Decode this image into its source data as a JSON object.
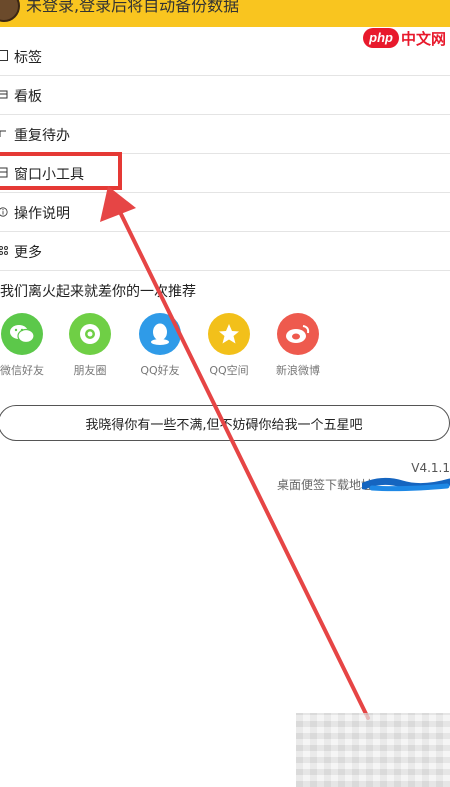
{
  "banner": {
    "text": "未登录,登录后将自动备份数据"
  },
  "watermark": {
    "badge": "php",
    "text": "中文网"
  },
  "menu": {
    "items": [
      {
        "label": "标签",
        "icon": "bookmark-icon"
      },
      {
        "label": "看板",
        "icon": "board-icon"
      },
      {
        "label": "重复待办",
        "icon": "repeat-icon"
      },
      {
        "label": "窗口小工具",
        "icon": "widget-icon"
      },
      {
        "label": "操作说明",
        "icon": "info-icon"
      },
      {
        "label": "更多",
        "icon": "more-icon"
      }
    ]
  },
  "share": {
    "title": "我们离火起来就差你的一次推荐",
    "targets": [
      {
        "label": "微信好友",
        "icon": "wechat-icon",
        "color": "#5cc84a"
      },
      {
        "label": "朋友圈",
        "icon": "moments-icon",
        "color": "#6fcf45"
      },
      {
        "label": "QQ好友",
        "icon": "qq-icon",
        "color": "#2f9be8"
      },
      {
        "label": "QQ空间",
        "icon": "qzone-icon",
        "color": "#f2c01a"
      },
      {
        "label": "新浪微博",
        "icon": "weibo-icon",
        "color": "#ee5a4e"
      }
    ]
  },
  "rate": {
    "label": "我晓得你有一些不满,但不妨碍你给我一个五星吧"
  },
  "footer": {
    "version": "V4.1.1",
    "download": "桌面便签下载地址"
  },
  "colors": {
    "banner": "#f9c51f",
    "highlight": "#e53935",
    "arrow": "#e64545"
  }
}
